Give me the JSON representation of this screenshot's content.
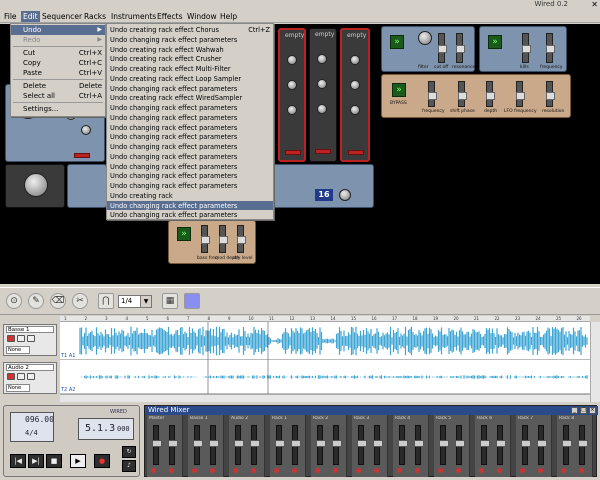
{
  "window": {
    "title": "Wired 0.2"
  },
  "menubar": [
    "File",
    "Edit",
    "Sequencer",
    "Racks",
    "Instruments",
    "Effects",
    "Window",
    "Help"
  ],
  "edit_menu": {
    "items": [
      {
        "label": "Undo",
        "shortcut": "",
        "submenu": true,
        "highlighted": true,
        "disabled": false
      },
      {
        "label": "Redo",
        "shortcut": "",
        "submenu": true,
        "highlighted": false,
        "disabled": true
      },
      {
        "label": "Cut",
        "shortcut": "Ctrl+X",
        "submenu": false,
        "highlighted": false,
        "disabled": false
      },
      {
        "label": "Copy",
        "shortcut": "Ctrl+C",
        "submenu": false,
        "highlighted": false,
        "disabled": false
      },
      {
        "label": "Paste",
        "shortcut": "Ctrl+V",
        "submenu": false,
        "highlighted": false,
        "disabled": false
      },
      {
        "label": "Delete",
        "shortcut": "Delete",
        "submenu": false,
        "highlighted": false,
        "disabled": false
      },
      {
        "label": "Select all",
        "shortcut": "Ctrl+A",
        "submenu": false,
        "highlighted": false,
        "disabled": false
      },
      {
        "label": "Settings...",
        "shortcut": "",
        "submenu": false,
        "highlighted": false,
        "disabled": false
      }
    ]
  },
  "undo_submenu": {
    "items": [
      {
        "label": "Undo creating rack effect Chorus",
        "shortcut": "Ctrl+Z"
      },
      {
        "label": "Undo changing rack effect parameters",
        "shortcut": ""
      },
      {
        "label": "Undo creating rack effect Wahwah",
        "shortcut": ""
      },
      {
        "label": "Undo creating rack effect Crusher",
        "shortcut": ""
      },
      {
        "label": "Undo creating rack effect Multi-Filter",
        "shortcut": ""
      },
      {
        "label": "Undo creating rack effect Loop Sampler",
        "shortcut": ""
      },
      {
        "label": "Undo changing rack effect parameters",
        "shortcut": ""
      },
      {
        "label": "Undo creating rack effect WiredSampler",
        "shortcut": ""
      },
      {
        "label": "Undo changing rack effect parameters",
        "shortcut": ""
      },
      {
        "label": "Undo changing rack effect parameters",
        "shortcut": ""
      },
      {
        "label": "Undo changing rack effect parameters",
        "shortcut": ""
      },
      {
        "label": "Undo changing rack effect parameters",
        "shortcut": ""
      },
      {
        "label": "Undo changing rack effect parameters",
        "shortcut": ""
      },
      {
        "label": "Undo changing rack effect parameters",
        "shortcut": ""
      },
      {
        "label": "Undo changing rack effect parameters",
        "shortcut": ""
      },
      {
        "label": "Undo changing rack effect parameters",
        "shortcut": ""
      },
      {
        "label": "Undo changing rack effect parameters",
        "shortcut": ""
      },
      {
        "label": "Undo creating rack",
        "shortcut": ""
      },
      {
        "label": "Undo changing rack effect parameters",
        "shortcut": ""
      },
      {
        "label": "Undo changing rack effect parameters",
        "shortcut": ""
      }
    ],
    "highlighted_index": 18
  },
  "rack": {
    "empty_label": "empty",
    "sampler_readout": "16",
    "bypass_label": "BYPASS",
    "chorus_labels": [
      "filter",
      "cut off",
      "resonance"
    ],
    "delay_labels": [
      "kills",
      "frequency"
    ],
    "flanger_labels": [
      "frequency",
      "shift phase",
      "depth",
      "LFO frequency",
      "resolution"
    ],
    "bottom_labels": [
      "bass freq",
      "mod depth",
      "dry level"
    ],
    "select_label": "select",
    "position_label": "POSITION"
  },
  "toolbar": {
    "snap_value": "1/4",
    "tools": [
      "pointer-tool",
      "pencil-tool",
      "eraser-tool",
      "split-tool"
    ]
  },
  "tracks": [
    {
      "name": "Basse 1",
      "mode": "None",
      "lane_tag": "T1 A1"
    },
    {
      "name": "Audio 2",
      "mode": "None",
      "lane_tag": "T2 A2"
    }
  ],
  "ruler_marks": [
    "1",
    "2",
    "3",
    "4",
    "5",
    "6",
    "7",
    "8",
    "9",
    "10",
    "11",
    "12",
    "13",
    "14",
    "15",
    "16",
    "17",
    "18",
    "19",
    "20",
    "21",
    "22",
    "23",
    "24",
    "25",
    "26"
  ],
  "transport": {
    "bpm": "096.00",
    "signature_num": "4",
    "signature_den": "4",
    "position": "5.1.3",
    "position_sub": "000",
    "logo": "WIRED"
  },
  "mixer": {
    "title": "Wired Mixer",
    "channels": [
      "Master",
      "Basse 1",
      "Audio 2",
      "Rack 1",
      "Rack 2",
      "Rack 3",
      "Rack 4",
      "Rack 5",
      "Rack 6",
      "Rack 7",
      "Rack 8"
    ]
  },
  "colors": {
    "waveform": "#3fa5d4",
    "menu_highlight": "#5a6e92",
    "rack_bg": "#000000",
    "mixer_title": "#2a4a8a"
  }
}
